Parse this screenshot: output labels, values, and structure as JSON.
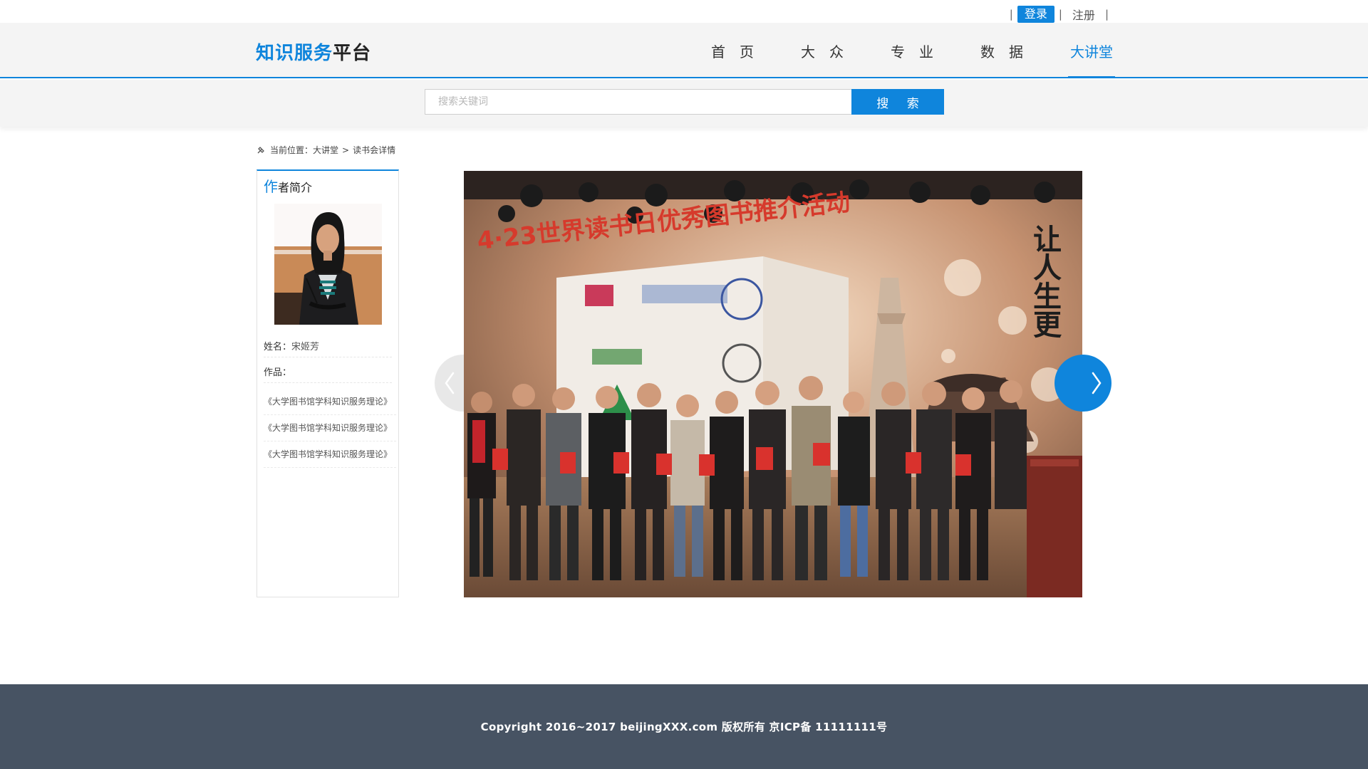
{
  "topbar": {
    "login_label": "登录",
    "register_label": "注册",
    "separator": "|"
  },
  "header": {
    "logo_blue": "知识服务",
    "logo_dark": "平台",
    "nav": [
      {
        "label": "首　页",
        "active": false
      },
      {
        "label": "大　众",
        "active": false
      },
      {
        "label": "专　业",
        "active": false
      },
      {
        "label": "数　据",
        "active": false
      },
      {
        "label": "大讲堂",
        "active": true
      }
    ]
  },
  "search": {
    "placeholder": "搜索关键词",
    "button_label": "搜 索"
  },
  "breadcrumb": {
    "prefix": "当前位置：",
    "parent": "大讲堂",
    "separator": ">",
    "current": "读书会详情"
  },
  "sidebar": {
    "title_first": "作",
    "title_rest": "者简介",
    "name_label": "姓名：",
    "name_value": "宋姬芳",
    "works_label": "作品：",
    "works": [
      "《大学图书馆学科知识服务理论》",
      "《大学图书馆学科知识服务理论》",
      "《大学图书馆学科知识服务理论》"
    ]
  },
  "banner": {
    "title": "4·23世界读书日优秀图书推介活动",
    "side_text": "让人生更"
  },
  "footer": {
    "copyright": "Copyright 2016~2017 beijingXXX.com 版权所有 京ICP备 11111111号"
  },
  "colors": {
    "accent": "#0f85dc",
    "footer_bg": "#475363",
    "header_bg": "#f4f4f4"
  },
  "icons": {
    "breadcrumb": "location-pin-icon",
    "prev": "chevron-left-icon",
    "next": "chevron-right-icon"
  }
}
